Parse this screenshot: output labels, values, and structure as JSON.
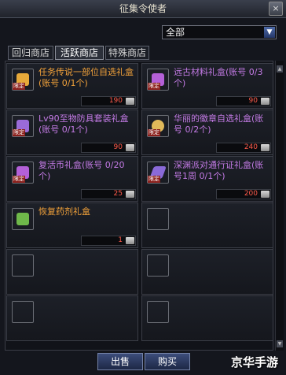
{
  "window": {
    "title": "征集令使者",
    "close_glyph": "×"
  },
  "filter": {
    "selected": "全部"
  },
  "tabs": [
    {
      "label": "回归商店"
    },
    {
      "label": "活跃商店"
    },
    {
      "label": "特殊商店"
    }
  ],
  "items": [
    {
      "name": "任务传说一部位自选礼盒(账号 0/1个)",
      "price": "190",
      "name_color": "#f2a23a",
      "badge": "限定",
      "icon": "gold-box-icon",
      "icon_color": "#e7a93a"
    },
    {
      "name": "远古材料礼盒(账号 0/3个)",
      "price": "90",
      "name_color": "#c47be6",
      "badge": "限定",
      "icon": "purple-box-icon",
      "icon_color": "#b460d8"
    },
    {
      "name": "Lv90至物防具套装礼盒(账号 0/1个)",
      "price": "90",
      "name_color": "#c47be6",
      "badge": "限定",
      "icon": "purple-box-icon",
      "icon_color": "#9a6bd8"
    },
    {
      "name": "华丽的徽章自选礼盒(账号 0/2个)",
      "price": "240",
      "name_color": "#c47be6",
      "badge": "限定",
      "icon": "gold-medal-icon",
      "icon_color": "#e0b95a"
    },
    {
      "name": "复活币礼盒(账号 0/20个)",
      "price": "25",
      "name_color": "#c47be6",
      "badge": "限定",
      "icon": "purple-box-icon",
      "icon_color": "#b460d8"
    },
    {
      "name": "深渊派对通行证礼盒(账号1周 0/1个)",
      "price": "200",
      "name_color": "#c47be6",
      "badge": "限定",
      "icon": "ticket-icon",
      "icon_color": "#8a6ad8"
    },
    {
      "name": "恢复药剂礼盒",
      "price": "1",
      "name_color": "#f2a23a",
      "badge": "",
      "icon": "potion-box-icon",
      "icon_color": "#6fb84a"
    }
  ],
  "buttons": {
    "sell": "出售",
    "buy": "购买"
  },
  "watermark": "京华手游"
}
